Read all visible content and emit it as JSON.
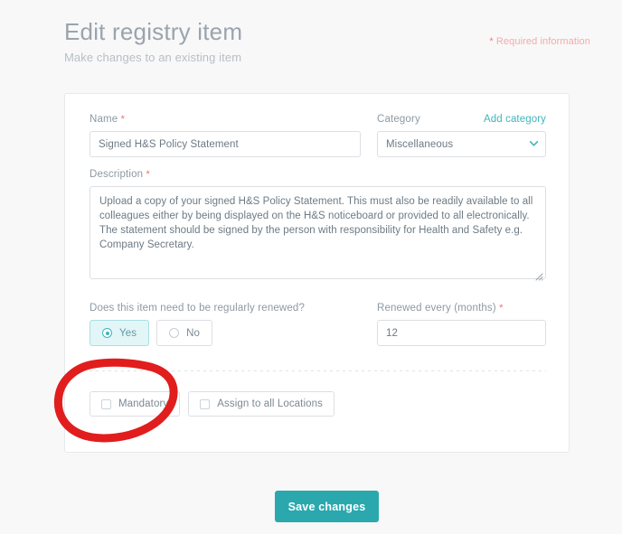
{
  "header": {
    "title": "Edit registry item",
    "subtitle": "Make changes to an existing item",
    "required_note": "Required information",
    "required_asterisk": "*"
  },
  "form": {
    "name": {
      "label": "Name",
      "required_marker": "*",
      "value": "Signed H&S Policy Statement",
      "placeholder": "Name"
    },
    "category": {
      "label": "Category",
      "add_link": "Add category",
      "selected": "Miscellaneous",
      "options": [
        "Miscellaneous"
      ]
    },
    "description": {
      "label": "Description",
      "required_marker": "*",
      "value": "Upload a copy of your signed H&S Policy Statement. This must also be readily available to all colleagues either by being displayed on the H&S noticeboard or provided to all electronically. The statement should be signed by the person with responsibility for Health and Safety e.g. Company Secretary.",
      "placeholder": "Description"
    },
    "renewal": {
      "question": "Does this item need to be regularly renewed?",
      "yes_label": "Yes",
      "no_label": "No",
      "selected": "Yes"
    },
    "renew_months": {
      "label": "Renewed every (months)",
      "required_marker": "*",
      "value": "12",
      "placeholder": "Months"
    },
    "checkboxes": {
      "mandatory_label": "Mandatory",
      "mandatory_checked": false,
      "assign_all_label": "Assign to all Locations",
      "assign_all_checked": false
    }
  },
  "actions": {
    "save_label": "Save changes"
  },
  "colors": {
    "accent_teal": "#2ba8ad",
    "link_teal": "#3fb6bd",
    "required_red": "#f26d6d",
    "annotation_red": "#e11d1d",
    "page_background": "#f8f8f9",
    "card_background": "#ffffff"
  },
  "annotation": {
    "shape": "hand-drawn-oval",
    "target": "mandatory-checkbox"
  }
}
